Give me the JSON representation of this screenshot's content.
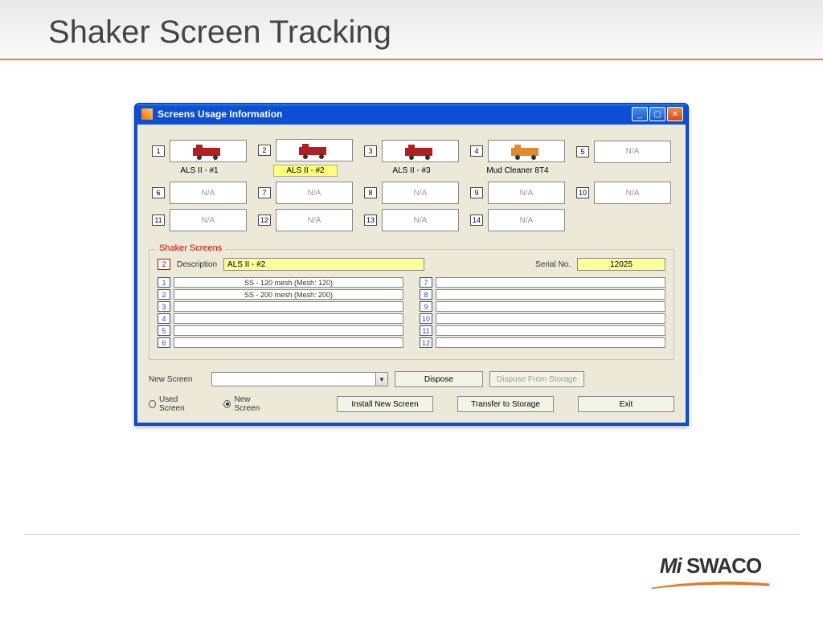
{
  "slide": {
    "title": "Shaker Screen Tracking"
  },
  "window": {
    "title": "Screens Usage Information"
  },
  "positions": [
    {
      "num": "1",
      "label": "ALS II - #1",
      "has_equipment": true,
      "selected": false,
      "type": "shaker"
    },
    {
      "num": "2",
      "label": "ALS II - #2",
      "has_equipment": true,
      "selected": true,
      "type": "shaker"
    },
    {
      "num": "3",
      "label": "ALS II - #3",
      "has_equipment": true,
      "selected": false,
      "type": "shaker"
    },
    {
      "num": "4",
      "label": "Mud Cleaner 8T4",
      "has_equipment": true,
      "selected": false,
      "type": "cleaner"
    },
    {
      "num": "5",
      "label": "N/A",
      "has_equipment": false,
      "selected": false
    },
    {
      "num": "6",
      "label": "N/A",
      "has_equipment": false,
      "selected": false
    },
    {
      "num": "7",
      "label": "N/A",
      "has_equipment": false,
      "selected": false
    },
    {
      "num": "8",
      "label": "N/A",
      "has_equipment": false,
      "selected": false
    },
    {
      "num": "9",
      "label": "N/A",
      "has_equipment": false,
      "selected": false
    },
    {
      "num": "10",
      "label": "N/A",
      "has_equipment": false,
      "selected": false
    },
    {
      "num": "11",
      "label": "N/A",
      "has_equipment": false,
      "selected": false
    },
    {
      "num": "12",
      "label": "N/A",
      "has_equipment": false,
      "selected": false
    },
    {
      "num": "13",
      "label": "N/A",
      "has_equipment": false,
      "selected": false
    },
    {
      "num": "14",
      "label": "N/A",
      "has_equipment": false,
      "selected": false
    }
  ],
  "group": {
    "title": "Shaker Screens"
  },
  "selected": {
    "position_num": "2",
    "desc_label": "Description",
    "description": "ALS II - #2",
    "serial_label": "Serial No.",
    "serial": "12025"
  },
  "slots": {
    "left": [
      "SS - 120 mesh  (Mesh: 120)",
      "SS - 200 mesh  (Mesh: 200)",
      "",
      "",
      "",
      ""
    ],
    "left_nums": [
      "1",
      "2",
      "3",
      "4",
      "5",
      "6"
    ],
    "right": [
      "",
      "",
      "",
      "",
      "",
      ""
    ],
    "right_nums": [
      "7",
      "8",
      "9",
      "10",
      "11",
      "12"
    ]
  },
  "bottom": {
    "new_screen_label": "New Screen",
    "dispose": "Dispose",
    "dispose_storage": "Dispose From Storage",
    "used_radio": "Used Screen",
    "new_radio": "New Screen",
    "install": "Install New Screen",
    "transfer": "Transfer to Storage",
    "exit": "Exit"
  },
  "brand": {
    "name": "Mi SWACO"
  }
}
